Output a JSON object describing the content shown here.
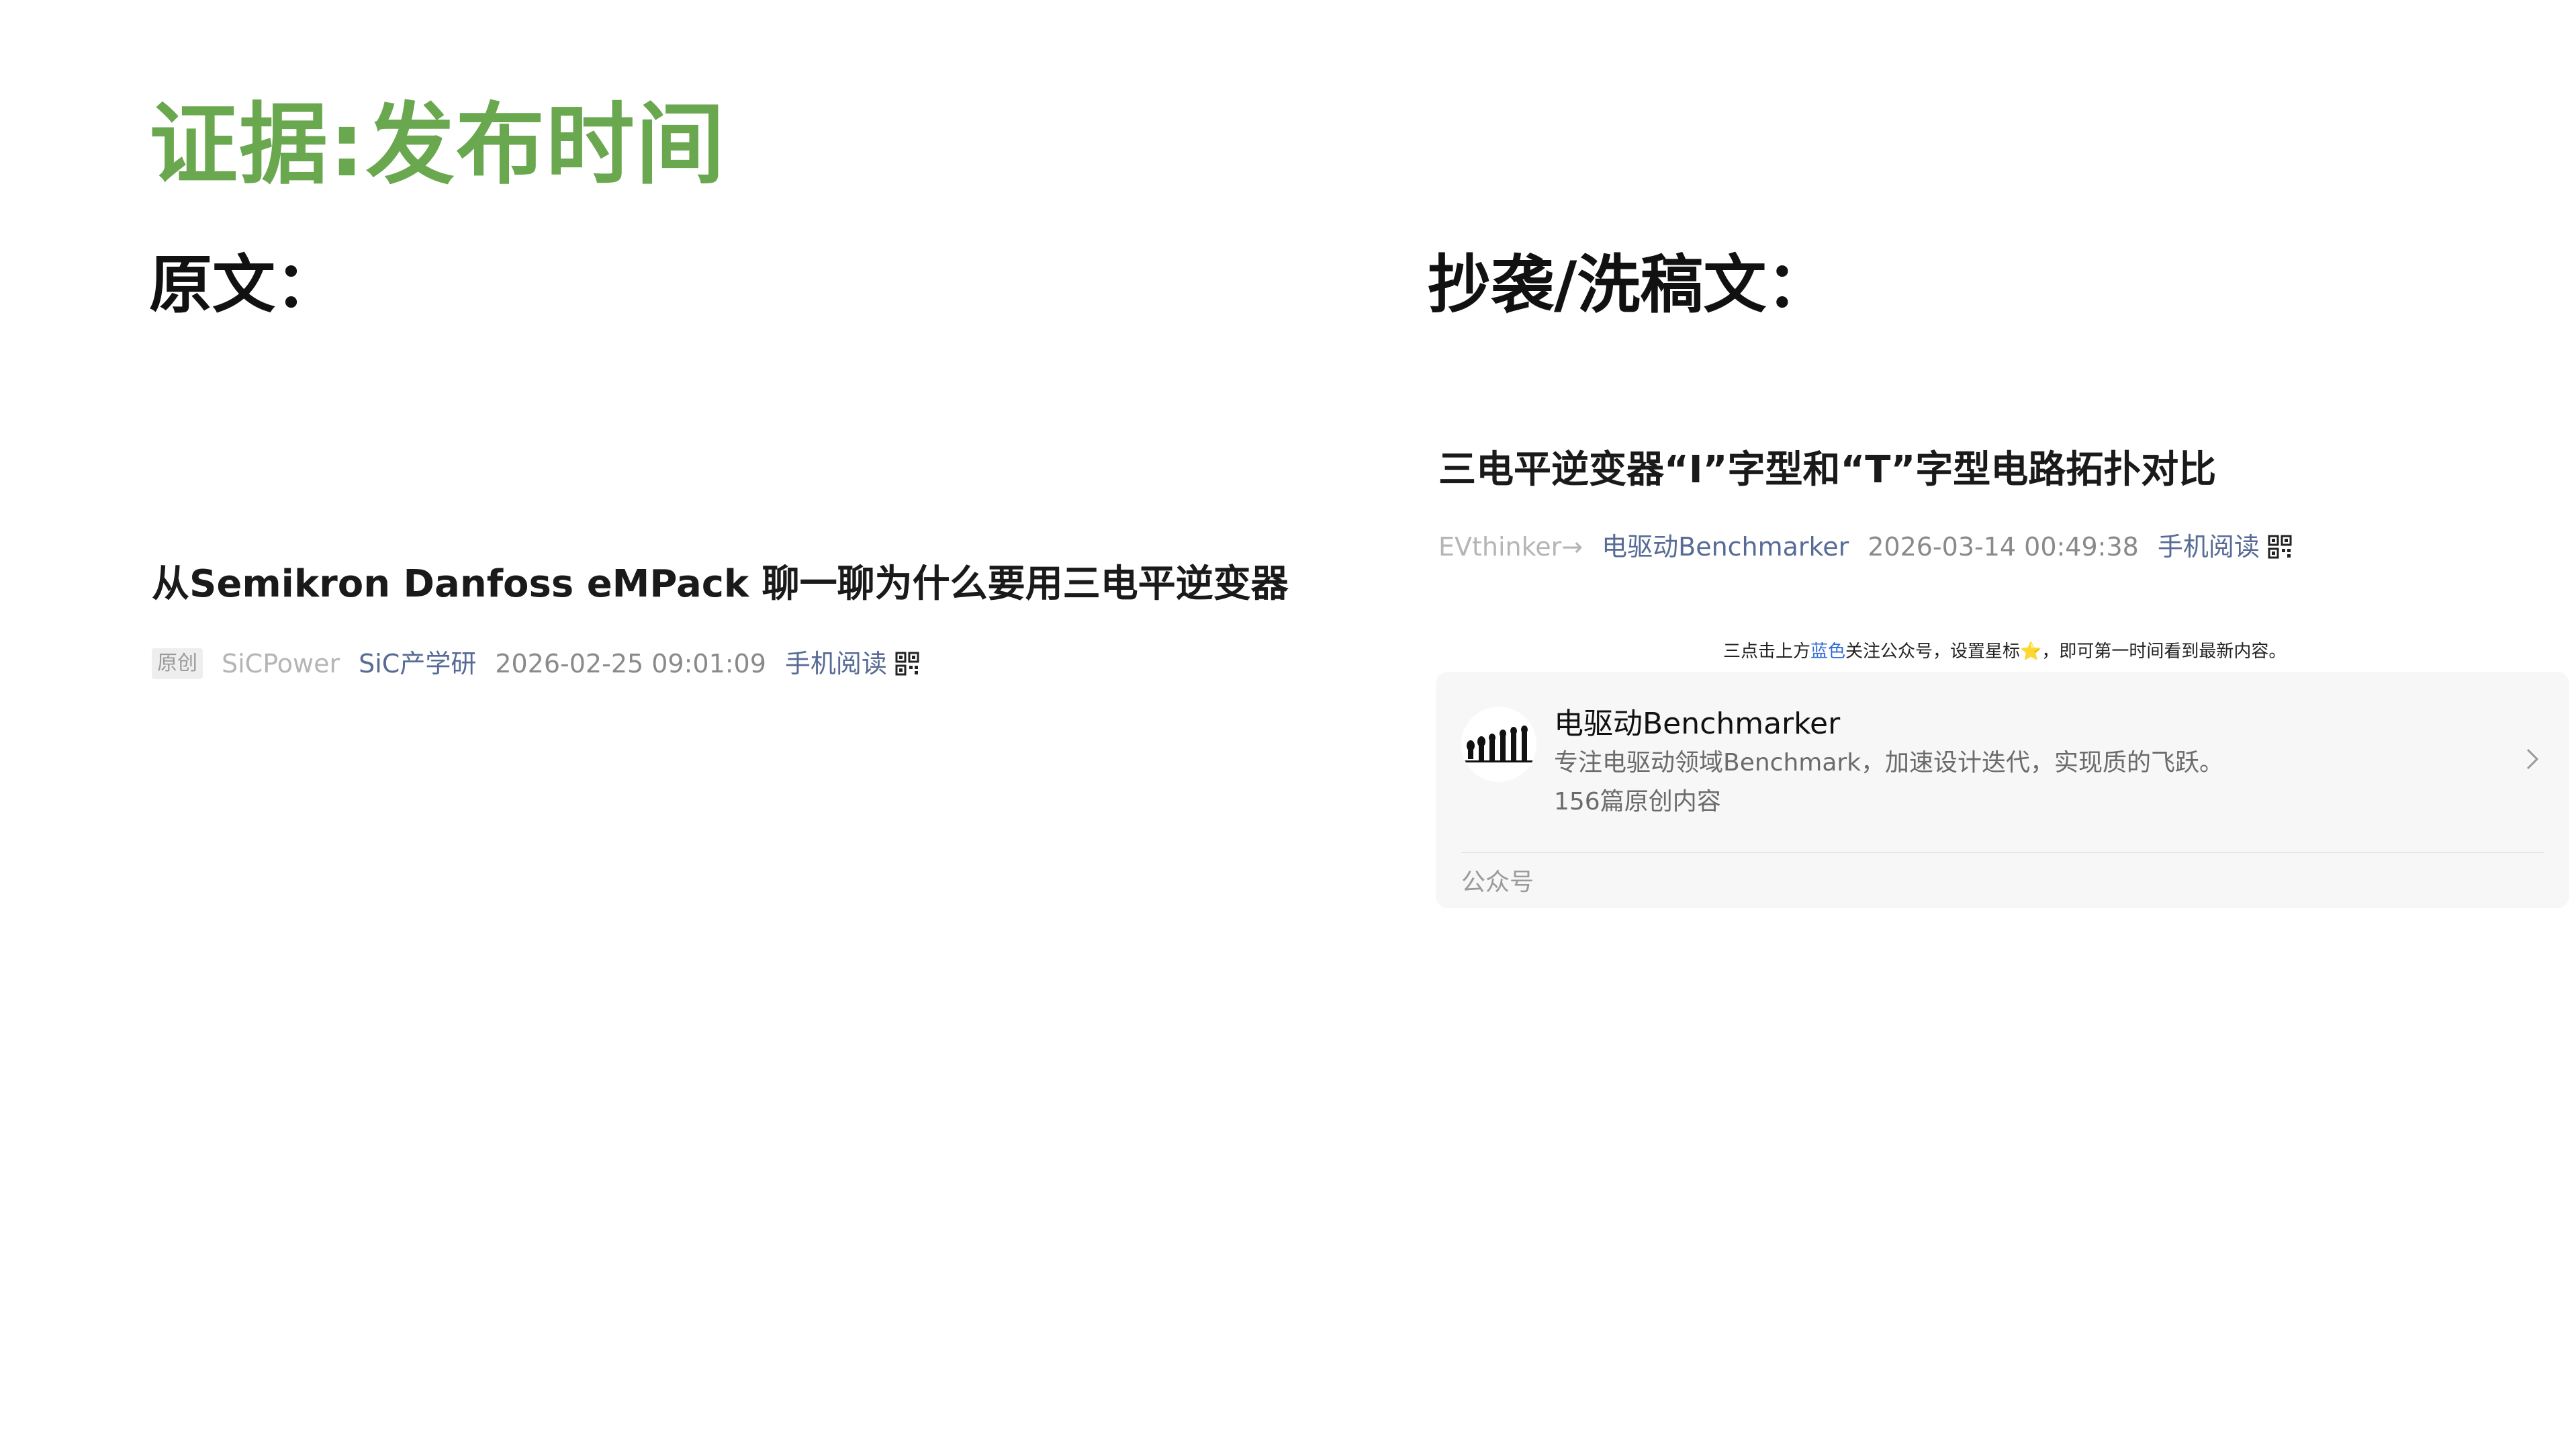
{
  "slide": {
    "title": "证据:发布时间",
    "original_heading": "原文：",
    "copy_heading": "抄袭/洗稿文："
  },
  "original_article": {
    "title": "从Semikron Danfoss eMPack 聊一聊为什么要用三电平逆变器",
    "original_tag": "原创",
    "author": "SiCPower",
    "account": "SiC产学研",
    "datetime": "2026-02-25 09:01:09",
    "mobile_read": "手机阅读",
    "qr_icon": "qr-code-icon"
  },
  "copy_article": {
    "title": "三电平逆变器“I”字型和“T”字型电路拓扑对比",
    "author": "EVthinker→",
    "account": "电驱动Benchmarker",
    "datetime": "2026-03-14 00:49:38",
    "mobile_read": "手机阅读",
    "qr_icon": "qr-code-icon",
    "follow_note": {
      "prefix": "三点击上方",
      "highlight": "蓝色",
      "suffix": "关注公众号，设置星标⭐，即可第一时间看到最新内容。"
    },
    "account_card": {
      "name": "电驱动Benchmarker",
      "description": "专注电驱动领域Benchmark，加速设计迭代，实现质的飞跃。",
      "count": "156篇原创内容",
      "type": "公众号",
      "chevron_icon": "chevron-right-icon"
    }
  },
  "colors": {
    "title_green": "#6aa84f",
    "link_blue": "#576b95",
    "highlight_blue": "#2f6bd8"
  }
}
